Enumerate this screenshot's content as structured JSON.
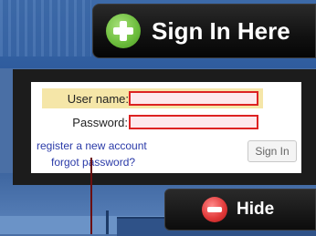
{
  "header": {
    "sign_in_here_label": "Sign In Here",
    "icon": "plus-circle-icon",
    "icon_color": "#6fbf3f"
  },
  "login_form": {
    "username_label": "User name:",
    "username_value": "",
    "password_label": "Password:",
    "password_value": "",
    "register_link": "register a new account",
    "forgot_link": "forgot password?",
    "sign_in_button": "Sign In",
    "field_border_color": "#dd2222",
    "link_color": "#2a3aa8"
  },
  "hide_panel": {
    "label": "Hide",
    "icon": "minus-circle-icon",
    "icon_color": "#e23b3b"
  }
}
